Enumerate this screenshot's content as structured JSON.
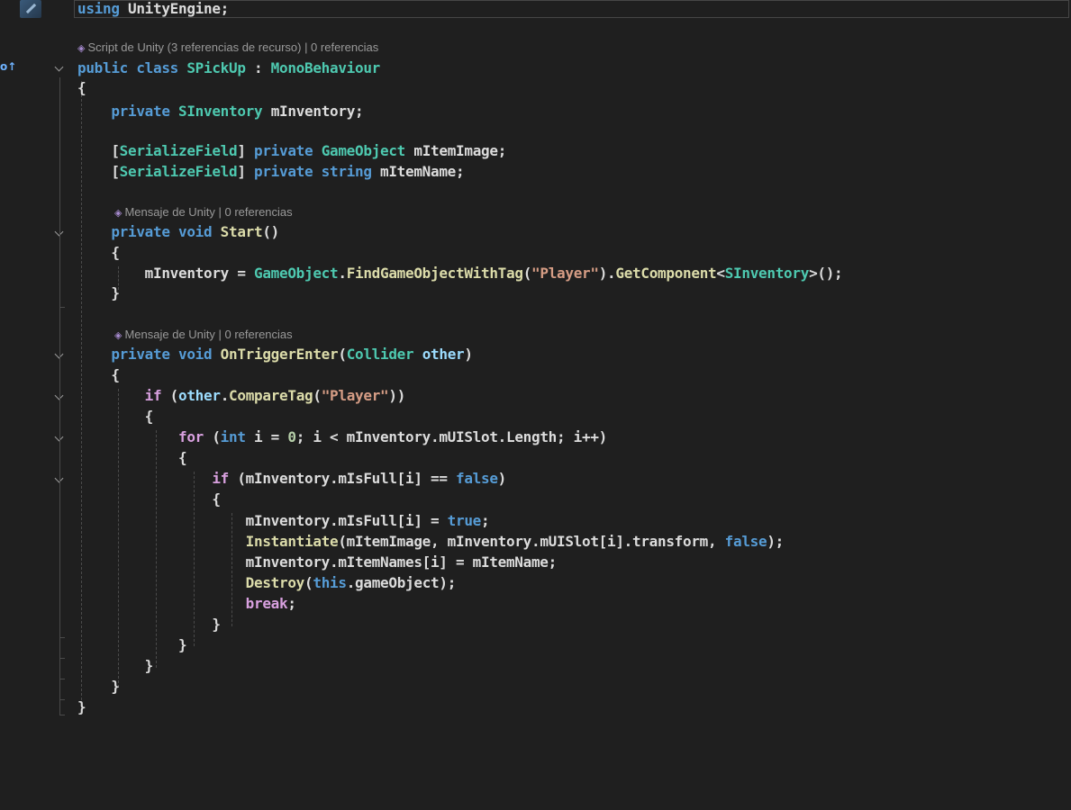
{
  "editor": {
    "language": "C#",
    "code_lines": [
      {
        "id": "l1",
        "segments": [
          {
            "c": "kw",
            "t": "using"
          },
          {
            "c": "ident",
            "t": " UnityEngine;"
          }
        ]
      },
      {
        "id": "l2",
        "segments": [
          {
            "c": "kw",
            "t": "public class "
          },
          {
            "c": "type",
            "t": "SPickUp"
          },
          {
            "c": "ident",
            "t": " : "
          },
          {
            "c": "type",
            "t": "MonoBehaviour"
          }
        ]
      },
      {
        "id": "l3",
        "segments": [
          {
            "c": "ident",
            "t": "{"
          }
        ]
      },
      {
        "id": "l4",
        "segments": [
          {
            "c": "ident",
            "t": "    "
          },
          {
            "c": "kw",
            "t": "private "
          },
          {
            "c": "type",
            "t": "SInventory"
          },
          {
            "c": "ident",
            "t": " mInventory;"
          }
        ]
      },
      {
        "id": "l5",
        "segments": [
          {
            "c": "ident",
            "t": "    ["
          },
          {
            "c": "attr",
            "t": "SerializeField"
          },
          {
            "c": "ident",
            "t": "] "
          },
          {
            "c": "kw",
            "t": "private "
          },
          {
            "c": "type",
            "t": "GameObject"
          },
          {
            "c": "ident",
            "t": " mItemImage;"
          }
        ]
      },
      {
        "id": "l6",
        "segments": [
          {
            "c": "ident",
            "t": "    ["
          },
          {
            "c": "attr",
            "t": "SerializeField"
          },
          {
            "c": "ident",
            "t": "] "
          },
          {
            "c": "kw",
            "t": "private string"
          },
          {
            "c": "ident",
            "t": " mItemName;"
          }
        ]
      },
      {
        "id": "l7",
        "segments": [
          {
            "c": "ident",
            "t": "    "
          },
          {
            "c": "kw",
            "t": "private void "
          },
          {
            "c": "fn",
            "t": "Start"
          },
          {
            "c": "ident",
            "t": "()"
          }
        ]
      },
      {
        "id": "l8",
        "segments": [
          {
            "c": "ident",
            "t": "    {"
          }
        ]
      },
      {
        "id": "l9",
        "segments": [
          {
            "c": "ident",
            "t": "        mInventory = "
          },
          {
            "c": "type",
            "t": "GameObject"
          },
          {
            "c": "ident",
            "t": "."
          },
          {
            "c": "fn",
            "t": "FindGameObjectWithTag"
          },
          {
            "c": "ident",
            "t": "("
          },
          {
            "c": "str",
            "t": "\"Player\""
          },
          {
            "c": "ident",
            "t": ")."
          },
          {
            "c": "fn",
            "t": "GetComponent"
          },
          {
            "c": "ident",
            "t": "<"
          },
          {
            "c": "type",
            "t": "SInventory"
          },
          {
            "c": "ident",
            "t": ">();"
          }
        ]
      },
      {
        "id": "l10",
        "segments": [
          {
            "c": "ident",
            "t": "    }"
          }
        ]
      },
      {
        "id": "l11",
        "segments": [
          {
            "c": "ident",
            "t": "    "
          },
          {
            "c": "kw",
            "t": "private void "
          },
          {
            "c": "fn",
            "t": "OnTriggerEnter"
          },
          {
            "c": "ident",
            "t": "("
          },
          {
            "c": "type",
            "t": "Collider"
          },
          {
            "c": "ident",
            "t": " "
          },
          {
            "c": "param",
            "t": "other"
          },
          {
            "c": "ident",
            "t": ")"
          }
        ]
      },
      {
        "id": "l12",
        "segments": [
          {
            "c": "ident",
            "t": "    {"
          }
        ]
      },
      {
        "id": "l13",
        "segments": [
          {
            "c": "ident",
            "t": "        "
          },
          {
            "c": "ctl",
            "t": "if"
          },
          {
            "c": "ident",
            "t": " ("
          },
          {
            "c": "param",
            "t": "other"
          },
          {
            "c": "ident",
            "t": "."
          },
          {
            "c": "fn",
            "t": "CompareTag"
          },
          {
            "c": "ident",
            "t": "("
          },
          {
            "c": "str",
            "t": "\"Player\""
          },
          {
            "c": "ident",
            "t": "))"
          }
        ]
      },
      {
        "id": "l14",
        "segments": [
          {
            "c": "ident",
            "t": "        {"
          }
        ]
      },
      {
        "id": "l15",
        "segments": [
          {
            "c": "ident",
            "t": "            "
          },
          {
            "c": "ctl",
            "t": "for"
          },
          {
            "c": "ident",
            "t": " ("
          },
          {
            "c": "kw",
            "t": "int"
          },
          {
            "c": "ident",
            "t": " i = "
          },
          {
            "c": "num",
            "t": "0"
          },
          {
            "c": "ident",
            "t": "; i < mInventory.mUISlot.Length; i++)"
          }
        ]
      },
      {
        "id": "l16",
        "segments": [
          {
            "c": "ident",
            "t": "            {"
          }
        ]
      },
      {
        "id": "l17",
        "segments": [
          {
            "c": "ident",
            "t": "                "
          },
          {
            "c": "ctl",
            "t": "if"
          },
          {
            "c": "ident",
            "t": " (mInventory.mIsFull[i] == "
          },
          {
            "c": "kw",
            "t": "false"
          },
          {
            "c": "ident",
            "t": ")"
          }
        ]
      },
      {
        "id": "l18",
        "segments": [
          {
            "c": "ident",
            "t": "                {"
          }
        ]
      },
      {
        "id": "l19",
        "segments": [
          {
            "c": "ident",
            "t": "                    mInventory.mIsFull[i] = "
          },
          {
            "c": "kw",
            "t": "true"
          },
          {
            "c": "ident",
            "t": ";"
          }
        ]
      },
      {
        "id": "l20",
        "segments": [
          {
            "c": "ident",
            "t": "                    "
          },
          {
            "c": "fn",
            "t": "Instantiate"
          },
          {
            "c": "ident",
            "t": "(mItemImage, mInventory.mUISlot[i].transform, "
          },
          {
            "c": "kw",
            "t": "false"
          },
          {
            "c": "ident",
            "t": ");"
          }
        ]
      },
      {
        "id": "l21",
        "segments": [
          {
            "c": "ident",
            "t": "                    mInventory.mItemNames[i] = mItemName;"
          }
        ]
      },
      {
        "id": "l22",
        "segments": [
          {
            "c": "ident",
            "t": "                    "
          },
          {
            "c": "fn",
            "t": "Destroy"
          },
          {
            "c": "ident",
            "t": "("
          },
          {
            "c": "kw",
            "t": "this"
          },
          {
            "c": "ident",
            "t": ".gameObject);"
          }
        ]
      },
      {
        "id": "l23",
        "segments": [
          {
            "c": "ident",
            "t": "                    "
          },
          {
            "c": "ctl",
            "t": "break"
          },
          {
            "c": "ident",
            "t": ";"
          }
        ]
      },
      {
        "id": "l24",
        "segments": [
          {
            "c": "ident",
            "t": "                }"
          }
        ]
      },
      {
        "id": "l25",
        "segments": [
          {
            "c": "ident",
            "t": "            }"
          }
        ]
      },
      {
        "id": "l26",
        "segments": [
          {
            "c": "ident",
            "t": "        }"
          }
        ]
      },
      {
        "id": "l27",
        "segments": [
          {
            "c": "ident",
            "t": "    }"
          }
        ]
      },
      {
        "id": "l28",
        "segments": [
          {
            "c": "ident",
            "t": "}"
          }
        ]
      }
    ],
    "codelens": [
      {
        "id": "c1",
        "text": "Script de Unity (3 referencias de recurso) | 0 referencias"
      },
      {
        "id": "c2",
        "text": "Mensaje de Unity | 0 referencias"
      },
      {
        "id": "c3",
        "text": "Mensaje de Unity | 0 referencias"
      }
    ],
    "margin_glyph": "o↑"
  }
}
